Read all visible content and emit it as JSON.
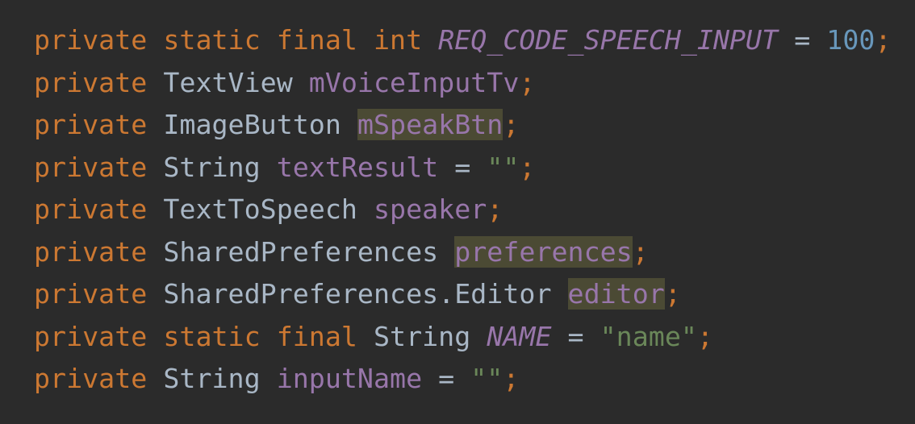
{
  "colors": {
    "background": "#2b2b2b",
    "keyword": "#cc7832",
    "type": "#a9b7c6",
    "field": "#9876aa",
    "number": "#6897bb",
    "string": "#6a8759",
    "highlight": "#4b4a34"
  },
  "lines": [
    {
      "mod1": "private",
      "mod2": "static",
      "mod3": "final",
      "type": "int",
      "name": "REQ_CODE_SPEECH_INPUT",
      "eq": "=",
      "value": "100",
      "semi": ";"
    },
    {
      "mod1": "private",
      "type": "TextView",
      "name": "mVoiceInputTv",
      "semi": ";"
    },
    {
      "mod1": "private",
      "type": "ImageButton",
      "name": "mSpeakBtn",
      "semi": ";"
    },
    {
      "mod1": "private",
      "type": "String",
      "name": "textResult",
      "eq": "=",
      "value": "\"\"",
      "semi": ";"
    },
    {
      "mod1": "private",
      "type": "TextToSpeech",
      "name": "speaker",
      "semi": ";"
    },
    {
      "mod1": "private",
      "type": "SharedPreferences",
      "name": "preferences",
      "semi": ";"
    },
    {
      "mod1": "private",
      "type": "SharedPreferences.Editor",
      "name": "editor",
      "semi": ";"
    },
    {
      "mod1": "private",
      "mod2": "static",
      "mod3": "final",
      "type": "String",
      "name": "NAME",
      "eq": "=",
      "value": "\"name\"",
      "semi": ";"
    },
    {
      "mod1": "private",
      "type": "String",
      "name": "inputName",
      "eq": "=",
      "value": "\"\"",
      "semi": ";"
    }
  ]
}
